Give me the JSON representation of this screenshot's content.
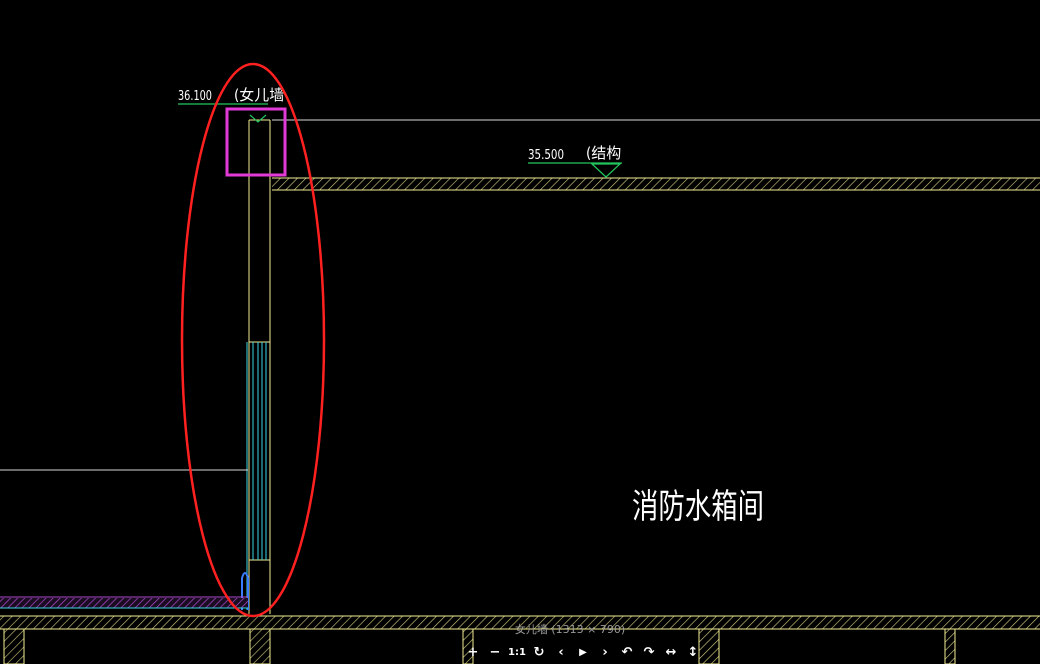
{
  "drawing": {
    "elev_parapet_value": "36.100",
    "elev_parapet_label": "(女儿墙",
    "elev_structure_value": "35.500",
    "elev_structure_label": "(结构",
    "room_label": "消防水箱间"
  },
  "viewer": {
    "caption": "女儿墙 (1313 × 790)",
    "tools": {
      "zoom_in": "+",
      "zoom_out": "−",
      "actual_size": "1:1",
      "refresh": "↻",
      "prev": "‹",
      "play": "▶",
      "next": "›",
      "rotate_left": "↶",
      "rotate_right": "↷",
      "flip_horizontal": "↔",
      "flip_vertical": "↕"
    }
  },
  "colors": {
    "background": "#000000",
    "wall_line": "#f2ee92",
    "level_line": "#ffffff",
    "elevation_mark": "#22c55e",
    "glazing": "#38d6e6",
    "annotation_ellipse": "#ff2020",
    "highlight_box": "#e23ad6",
    "floor_finish": "#b04bd0"
  }
}
